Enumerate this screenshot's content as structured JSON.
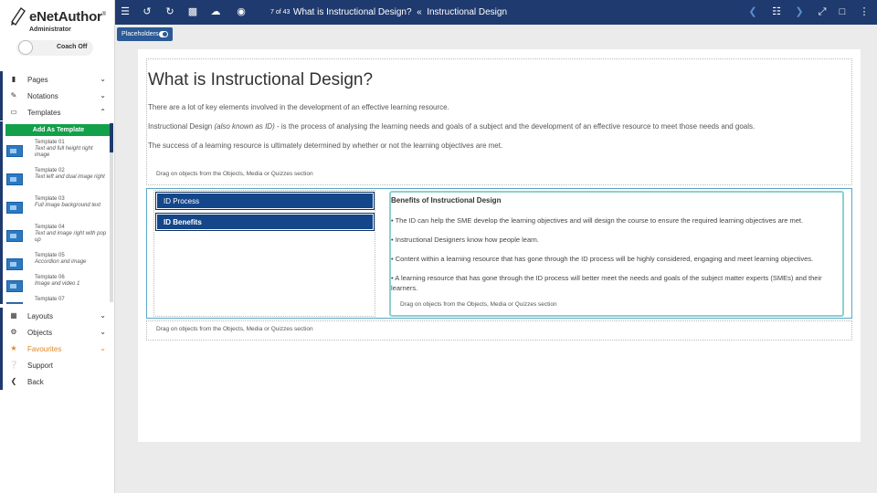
{
  "app": {
    "logo_text": "eNetAuthor",
    "logo_reg": "®",
    "role": "Administrator",
    "coach_label": "Coach Off"
  },
  "sidebar": {
    "items": [
      {
        "label": "Pages",
        "icon": "file-icon"
      },
      {
        "label": "Notations",
        "icon": "edit-icon"
      },
      {
        "label": "Templates",
        "icon": "monitor-icon"
      },
      {
        "label": "Layouts",
        "icon": "grid-icon"
      },
      {
        "label": "Objects",
        "icon": "gears-icon"
      },
      {
        "label": "Favourites",
        "icon": "star-icon"
      },
      {
        "label": "Support",
        "icon": "question-icon"
      },
      {
        "label": "Back",
        "icon": "back-icon"
      }
    ],
    "add_template_label": "Add As Template",
    "templates": [
      {
        "title": "Template 01",
        "desc": "Text and full height right image"
      },
      {
        "title": "Template 02",
        "desc": "Text left and dual image right"
      },
      {
        "title": "Template 03",
        "desc": "Full image background text"
      },
      {
        "title": "Template 04",
        "desc": "Text and image right with pop up"
      },
      {
        "title": "Template 05",
        "desc": "Accordion and image"
      },
      {
        "title": "Template 06",
        "desc": "Image and video 1"
      },
      {
        "title": "Template 07",
        "desc": ""
      }
    ]
  },
  "toolbar": {
    "page_counter": "7 of 43",
    "page_title": "What is Instructional Design?",
    "separator": "«",
    "section_title": "Instructional Design",
    "placeholders_label": "Placeholders"
  },
  "content": {
    "heading": "What is Instructional Design?",
    "para1": "There are a lot of key elements involved in the development of an effective learning resource.",
    "para2_prefix": "Instructional Design ",
    "para2_italic": "(also known as ID)",
    "para2_suffix": " - is the process of analysing the learning needs and goals of a subject and the development of an effective resource to meet those needs and goals.",
    "para3": "The success of a learning resource is ultimately determined by whether or not the learning objectives are met.",
    "drag_hint": "Drag on objects from the Objects, Media or Quizzes section",
    "tabs": [
      "ID Process",
      "ID Benefits"
    ],
    "panel_title": "Benefits of Instructional Design",
    "bullets": [
      "• The ID can help the SME develop the learning objectives and will design the course to ensure the required learning objectives are met.",
      "• Instructional Designers know how people learn.",
      "• Content within a learning resource that has gone through the ID process will be highly considered, engaging and meet learning objectives.",
      "• A learning resource that has gone through the ID process will better meet the needs and goals of the subject matter experts (SMEs) and their learners."
    ]
  },
  "colors": {
    "topbar": "#1f3a6e",
    "add_template": "#12a04a",
    "tab": "#14468a",
    "favourites": "#e0872b",
    "panel_border": "#8ecfcf"
  }
}
